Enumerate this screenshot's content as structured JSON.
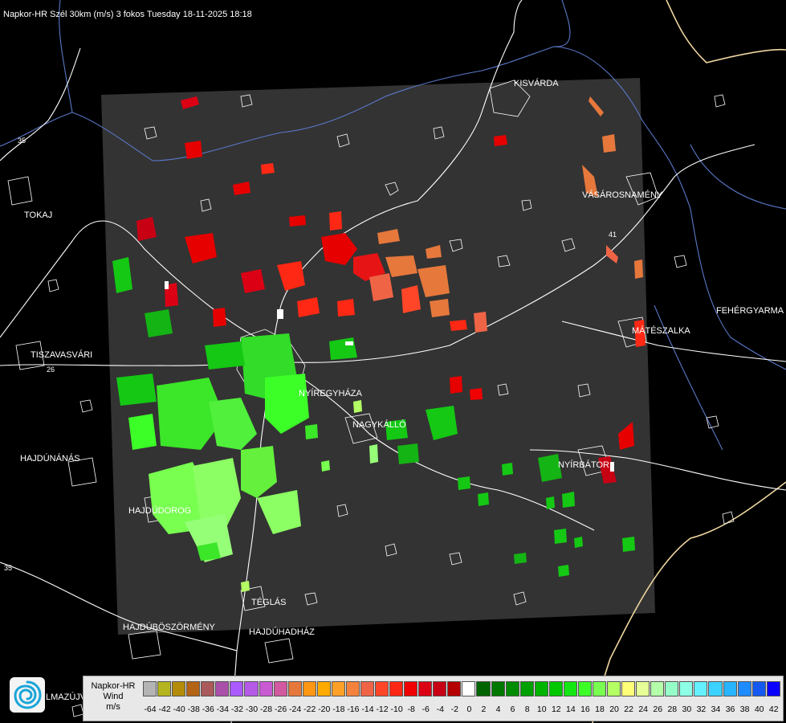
{
  "title": "Napkor-HR Szél 30km (m/s) 3 fokos Tuesday 18-11-2025 18:18",
  "cities": [
    "KISVÁRDA",
    "TOKAJ",
    "VÁSÁROSNAMÉNY",
    "FEHÉRGYARMA",
    "MÁTÉSZALKA",
    "TISZAVASVÁRI",
    "NYÍREGYHÁZA",
    "NAGYKÁLLÓ",
    "HAJDÚNÁNÁS",
    "NYÍRBÁTOR",
    "HAJDÚDOROG",
    "TÉGLÁS",
    "HAJDÚBÖSZÖRMÉNY",
    "HAJDÚHADHÁZ"
  ],
  "road_numbers": [
    "35",
    "26",
    "41",
    "35"
  ],
  "logo_caption": "LMAZÚJVÁR",
  "legend": {
    "line1": "Napkor-HR",
    "line2": "Wind",
    "line3": "m/s",
    "ticks": [
      "-64",
      "-42",
      "-40",
      "-38",
      "-36",
      "-34",
      "-32",
      "-30",
      "-28",
      "-26",
      "-24",
      "-22",
      "-20",
      "-18",
      "-16",
      "-14",
      "-12",
      "-10",
      "-8",
      "-6",
      "-4",
      "-2",
      "0",
      "2",
      "4",
      "6",
      "8",
      "10",
      "12",
      "14",
      "16",
      "18",
      "20",
      "22",
      "24",
      "26",
      "28",
      "30",
      "32",
      "34",
      "36",
      "38",
      "40",
      "42"
    ],
    "colors": [
      "#b4b4b4",
      "#b4b41e",
      "#b48c0a",
      "#b46414",
      "#aa5a5a",
      "#aa50aa",
      "#aa5aff",
      "#b45ae6",
      "#c85ad2",
      "#d25aa0",
      "#e6783c",
      "#ff9614",
      "#ffaa00",
      "#ffa028",
      "#f5823c",
      "#f06446",
      "#ff4628",
      "#ff2814",
      "#f00000",
      "#dc0014",
      "#c80014",
      "#b40000",
      "#ffffff",
      "#006400",
      "#007800",
      "#008c00",
      "#00a000",
      "#00b400",
      "#00c800",
      "#14e614",
      "#3cff28",
      "#78ff50",
      "#b4ff64",
      "#ffff78",
      "#e6ff96",
      "#b4ffaa",
      "#96ffc8",
      "#8cffe6",
      "#64f0ff",
      "#3cd2ff",
      "#28b4ff",
      "#1e8cff",
      "#145af0",
      "#0a00ff"
    ]
  },
  "map_colors": {
    "background": "#000000",
    "radar_area": "#333333",
    "river": "#5a78c8",
    "border": "#f0d7a0",
    "road": "#ffffff",
    "city_outline": "#ffffff"
  }
}
